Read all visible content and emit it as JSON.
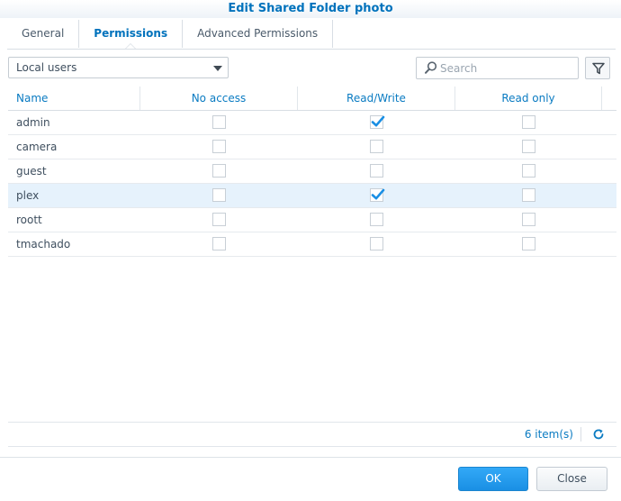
{
  "window": {
    "title": "Edit Shared Folder photo"
  },
  "tabs": [
    {
      "label": "General"
    },
    {
      "label": "Permissions"
    },
    {
      "label": "Advanced Permissions"
    }
  ],
  "toolbar": {
    "user_type": "Local users",
    "search_placeholder": "Search"
  },
  "grid": {
    "columns": [
      "Name",
      "No access",
      "Read/Write",
      "Read only"
    ],
    "rows": [
      {
        "name": "admin",
        "no_access": false,
        "read_write": true,
        "read_only": false
      },
      {
        "name": "camera",
        "no_access": false,
        "read_write": false,
        "read_only": false
      },
      {
        "name": "guest",
        "no_access": false,
        "read_write": false,
        "read_only": false
      },
      {
        "name": "plex",
        "no_access": false,
        "read_write": true,
        "read_only": false,
        "selected": true
      },
      {
        "name": "roott",
        "no_access": false,
        "read_write": false,
        "read_only": false
      },
      {
        "name": "tmachado",
        "no_access": false,
        "read_write": false,
        "read_only": false
      }
    ]
  },
  "pager": {
    "count": "6 item(s)"
  },
  "footer": {
    "ok_label": "OK",
    "close_label": "Close"
  },
  "colors": {
    "accent": "#0072bc",
    "check": "#1a8fe4",
    "selected_row": "#e6f2fc"
  }
}
